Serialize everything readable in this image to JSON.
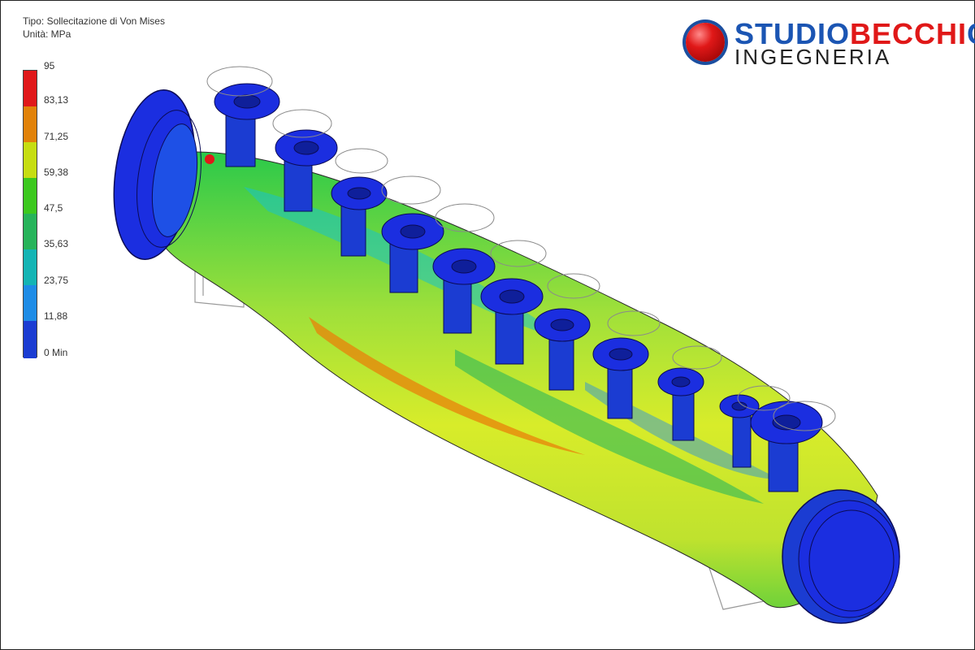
{
  "header": {
    "type_line": "Tipo: Sollecitazione di Von Mises",
    "unit_line": "Unità: MPa"
  },
  "legend": {
    "labels": [
      "95",
      "83,13",
      "71,25",
      "59,38",
      "47,5",
      "35,63",
      "23,75",
      "11,88",
      "0 Min"
    ],
    "colors": [
      "#e0181a",
      "#e1820a",
      "#c6dd12",
      "#3cc81e",
      "#27b35a",
      "#14b4b4",
      "#1e8ce6",
      "#1b3cd2"
    ]
  },
  "logo": {
    "line1_part1": "STUDIO",
    "line1_part2": "BECCHI",
    "line1_part3": "O",
    "line2": "INGEGNERIA"
  },
  "colors": {
    "accent_blue": "#1b55b3",
    "accent_red": "#e01818",
    "flange_blue": "#1b2ee0"
  }
}
